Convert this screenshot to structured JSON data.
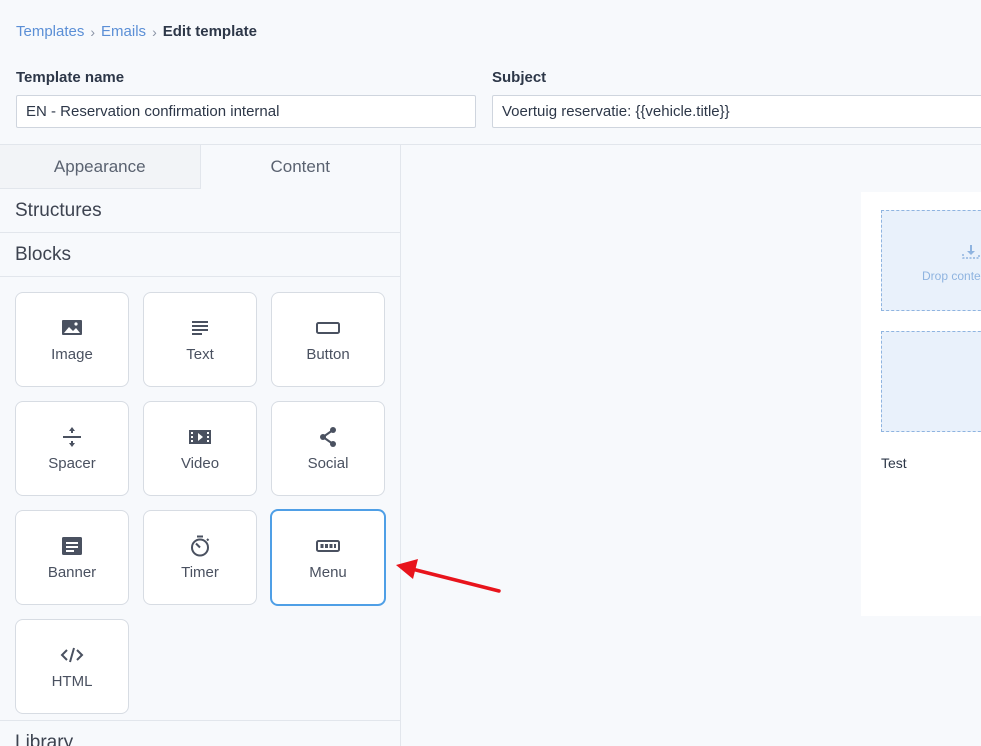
{
  "breadcrumb": {
    "items": [
      "Templates",
      "Emails"
    ],
    "separator": "›",
    "current": "Edit template"
  },
  "form": {
    "template_name_label": "Template name",
    "template_name_value": "EN - Reservation confirmation internal",
    "subject_label": "Subject",
    "subject_value": "Voertuig reservatie: {{vehicle.title}}"
  },
  "sidebar": {
    "tabs": [
      "Appearance",
      "Content"
    ],
    "active_tab": "Content",
    "sections": {
      "structures": "Structures",
      "blocks": "Blocks",
      "library": "Library"
    },
    "blocks": [
      {
        "label": "Image",
        "icon": "image-icon"
      },
      {
        "label": "Text",
        "icon": "text-icon"
      },
      {
        "label": "Button",
        "icon": "button-icon"
      },
      {
        "label": "Spacer",
        "icon": "spacer-icon"
      },
      {
        "label": "Video",
        "icon": "video-icon"
      },
      {
        "label": "Social",
        "icon": "share-icon"
      },
      {
        "label": "Banner",
        "icon": "banner-icon"
      },
      {
        "label": "Timer",
        "icon": "timer-icon"
      },
      {
        "label": "Menu",
        "icon": "menu-icon"
      },
      {
        "label": "HTML",
        "icon": "code-icon"
      }
    ],
    "selected_block": "Menu"
  },
  "canvas": {
    "drop_text": "Drop conte",
    "test_text": "Test"
  },
  "colors": {
    "link": "#5b8fd6",
    "selected_border": "#4f9fe6",
    "annotation_arrow": "#e8141c",
    "drop_zone_fill": "#e9f1fb"
  }
}
